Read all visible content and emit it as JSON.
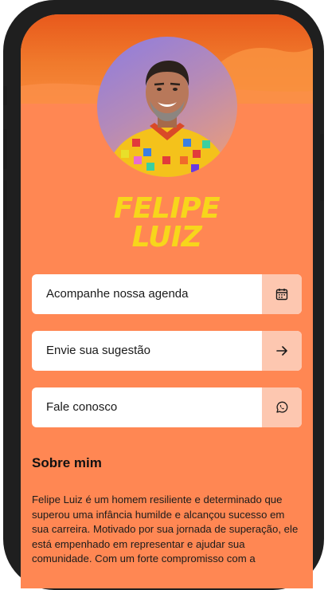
{
  "profile": {
    "name_line1": "FELIPE",
    "name_line2": "LUIZ"
  },
  "links": [
    {
      "label": "Acompanhe nossa agenda",
      "icon": "calendar-icon"
    },
    {
      "label": "Envie sua sugestão",
      "icon": "arrow-right-icon"
    },
    {
      "label": "Fale conosco",
      "icon": "whatsapp-icon"
    }
  ],
  "about": {
    "title": "Sobre mim",
    "text": "Felipe Luiz é um homem resiliente e determinado que superou uma infância humilde e alcançou sucesso em sua carreira. Motivado por sua jornada de superação, ele está empenhado em representar e ajudar sua comunidade. Com um forte compromisso com a"
  },
  "colors": {
    "background": "#ff8753",
    "accent_name": "#f7d61b",
    "icon_box": "#fdc7b0"
  }
}
